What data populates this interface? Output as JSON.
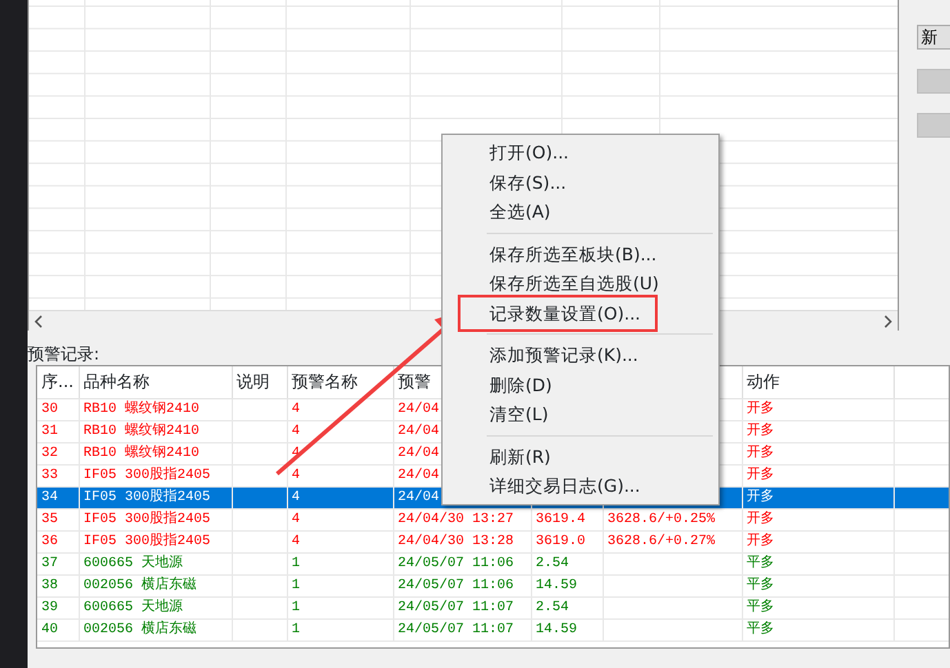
{
  "side_buttons": [
    {
      "label": "新",
      "disabled": false
    },
    {
      "disabled": true
    },
    {
      "disabled": true
    }
  ],
  "records_label": "预警记录:",
  "table": {
    "columns": [
      "序...",
      "品种名称",
      "说明",
      "预警名称",
      "预警",
      "",
      "",
      "动作",
      ""
    ],
    "rows": [
      {
        "cells": [
          "30",
          "RB10 螺纹钢2410",
          "",
          "4",
          "24/04",
          "",
          "",
          "开多"
        ],
        "color": "#ff0000",
        "selected": false
      },
      {
        "cells": [
          "31",
          "RB10 螺纹钢2410",
          "",
          "4",
          "24/04",
          "",
          "",
          "开多"
        ],
        "color": "#ff0000",
        "selected": false
      },
      {
        "cells": [
          "32",
          "RB10 螺纹钢2410",
          "",
          "4",
          "24/04",
          "",
          "",
          "开多"
        ],
        "color": "#ff0000",
        "selected": false
      },
      {
        "cells": [
          "33",
          "IF05 300股指2405",
          "",
          "4",
          "24/04",
          "",
          "",
          "开多"
        ],
        "color": "#ff0000",
        "selected": false
      },
      {
        "cells": [
          "34",
          "IF05 300股指2405",
          "",
          "4",
          "24/04",
          "",
          "",
          "开多"
        ],
        "selected": true
      },
      {
        "cells": [
          "35",
          "IF05 300股指2405",
          "",
          "4",
          "24/04/30 13:27",
          "3619.4",
          "3628.6/+0.25%",
          "开多"
        ],
        "color": "#ff0000",
        "selected": false
      },
      {
        "cells": [
          "36",
          "IF05 300股指2405",
          "",
          "4",
          "24/04/30 13:28",
          "3619.0",
          "3628.6/+0.27%",
          "开多"
        ],
        "color": "#ff0000",
        "selected": false
      },
      {
        "cells": [
          "37",
          "600665 天地源",
          "",
          "1",
          "24/05/07 11:06",
          "2.54",
          "",
          "平多"
        ],
        "color": "#008000",
        "selected": false
      },
      {
        "cells": [
          "38",
          "002056 横店东磁",
          "",
          "1",
          "24/05/07 11:06",
          "14.59",
          "",
          "平多"
        ],
        "color": "#008000",
        "selected": false
      },
      {
        "cells": [
          "39",
          "600665 天地源",
          "",
          "1",
          "24/05/07 11:07",
          "2.54",
          "",
          "平多"
        ],
        "color": "#008000",
        "selected": false
      },
      {
        "cells": [
          "40",
          "002056 横店东磁",
          "",
          "1",
          "24/05/07 11:07",
          "14.59",
          "",
          "平多"
        ],
        "color": "#008000",
        "selected": false
      }
    ]
  },
  "context_menu": {
    "items": [
      {
        "kind": "item",
        "label": "打开(O)...",
        "annotated": false
      },
      {
        "kind": "item",
        "label": "保存(S)...",
        "annotated": false
      },
      {
        "kind": "item",
        "label": "全选(A)",
        "annotated": false
      },
      {
        "kind": "separator"
      },
      {
        "kind": "item",
        "label": "保存所选至板块(B)...",
        "annotated": false
      },
      {
        "kind": "item",
        "label": "保存所选至自选股(U)",
        "annotated": false
      },
      {
        "kind": "item",
        "label": "记录数量设置(O)...",
        "annotated": true
      },
      {
        "kind": "separator"
      },
      {
        "kind": "item",
        "label": "添加预警记录(K)...",
        "annotated": false
      },
      {
        "kind": "item",
        "label": "删除(D)",
        "annotated": false
      },
      {
        "kind": "item",
        "label": "清空(L)",
        "annotated": false
      },
      {
        "kind": "separator"
      },
      {
        "kind": "item",
        "label": "刷新(R)",
        "annotated": false
      },
      {
        "kind": "item",
        "label": "详细交易日志(G)...",
        "annotated": false
      }
    ]
  }
}
